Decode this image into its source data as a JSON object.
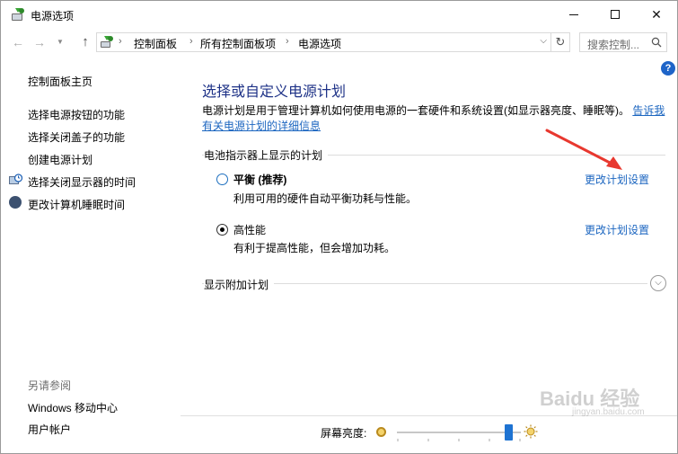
{
  "window": {
    "title": "电源选项",
    "controls": {
      "minimize": "—",
      "maximize": "☐",
      "close": "✕"
    }
  },
  "addressbar": {
    "breadcrumbs": [
      "控制面板",
      "所有控制面板项",
      "电源选项"
    ],
    "search_placeholder": "搜索控制..."
  },
  "sidebar": {
    "home": "控制面板主页",
    "links": [
      "选择电源按钮的功能",
      "选择关闭盖子的功能",
      "创建电源计划",
      "选择关闭显示器的时间",
      "更改计算机睡眠时间"
    ],
    "see_also_title": "另请参阅",
    "see_also": [
      "Windows 移动中心",
      "用户帐户"
    ]
  },
  "main": {
    "title": "选择或自定义电源计划",
    "description": "电源计划是用于管理计算机如何使用电源的一套硬件和系统设置(如显示器亮度、睡眠等)。",
    "tell_me_link": "告诉我有关电源计划的详细信息",
    "section_battery": "电池指示器上显示的计划",
    "plans": [
      {
        "name": "平衡 (推荐)",
        "description": "利用可用的硬件自动平衡功耗与性能。",
        "link": "更改计划设置",
        "selected": false
      },
      {
        "name": "高性能",
        "description": "有利于提高性能，但会增加功耗。",
        "link": "更改计划设置",
        "selected": true
      }
    ],
    "section_more": "显示附加计划"
  },
  "brightness": {
    "label": "屏幕亮度:",
    "level_fraction": 0.9
  },
  "colors": {
    "title_blue": "#1e3287",
    "link_blue": "#1c66c0",
    "annotation_red": "#e8382f"
  },
  "watermark": "Baidu 经验 jingyan.baidu.com"
}
